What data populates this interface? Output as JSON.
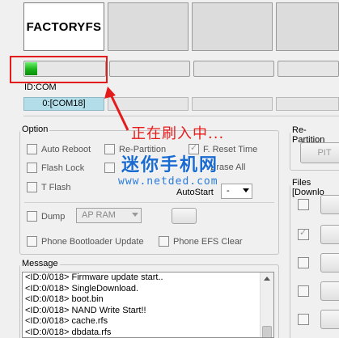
{
  "port_panel": {
    "slots": [
      {
        "title": "FACTORYFS",
        "active": true
      },
      {
        "title": "",
        "active": false
      },
      {
        "title": "",
        "active": false
      },
      {
        "title": "",
        "active": false
      }
    ],
    "progress": [
      0.15,
      0,
      0,
      0
    ],
    "id_com_label": "ID:COM",
    "com_ports": [
      "0:[COM18]",
      "",
      "",
      ""
    ]
  },
  "option": {
    "title": "Option",
    "auto_reboot": {
      "label": "Auto Reboot",
      "checked": false
    },
    "re_partition": {
      "label": "Re-Partition",
      "checked": false
    },
    "f_reset_time": {
      "label": "F. Reset Time",
      "checked": true
    },
    "flash_lock": {
      "label": "Flash Lock",
      "checked": false
    },
    "erase_all": {
      "label": "Erase All",
      "checked": false
    },
    "t_flash": {
      "label": "T Flash",
      "checked": false
    },
    "auto_start_label": "AutoStart",
    "auto_start_value": "-",
    "dump": {
      "label": "Dump",
      "checked": false
    },
    "dump_select_value": "AP RAM",
    "phone_bootloader_update": {
      "label": "Phone Bootloader Update",
      "checked": false
    },
    "phone_efs_clear": {
      "label": "Phone EFS Clear",
      "checked": false
    }
  },
  "right_panel": {
    "re_partition_title": "Re-Partition",
    "pit_button_label": "PIT",
    "files_title": "Files [Downlo",
    "file_rows": [
      {
        "checked": false
      },
      {
        "checked": true
      },
      {
        "checked": false
      },
      {
        "checked": false
      },
      {
        "checked": false
      }
    ]
  },
  "message": {
    "title": "Message",
    "lines": [
      "<ID:0/018> Firmware update start..",
      "<ID:0/018> SingleDownload.",
      "<ID:0/018> boot.bin",
      "<ID:0/018> NAND Write Start!!",
      "<ID:0/018> cache.rfs",
      "<ID:0/018> dbdata.rfs"
    ]
  },
  "annotation": {
    "text": "正在刷入中...",
    "color": "#e41b1b"
  },
  "watermark": {
    "site_name": "迷你手机网",
    "url": "www.netded.com",
    "color": "#1a6bd1"
  }
}
